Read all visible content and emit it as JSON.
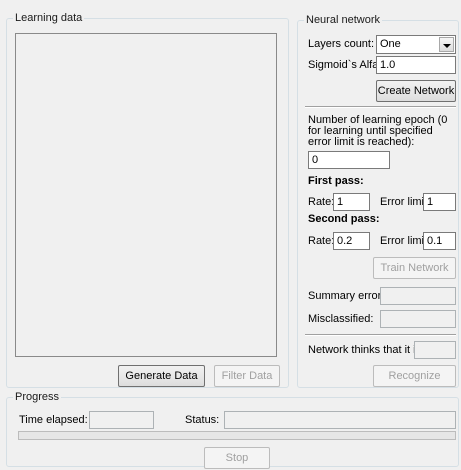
{
  "learning_data": {
    "title": "Learning data",
    "generate_label": "Generate Data",
    "filter_label": "Filter Data"
  },
  "neural_network": {
    "title": "Neural network",
    "layers_label": "Layers count:",
    "layers_value": "One",
    "alfa_label": "Sigmoid`s Alfa:",
    "alfa_value": "1.0",
    "create_label": "Create Network",
    "epoch_label": "Number of learning epoch (0 for learning until specified error limit is reached):",
    "epoch_value": "0",
    "first_pass_label": "First pass:",
    "first_rate_label": "Rate:",
    "first_rate_value": "1",
    "first_limit_label": "Error limit",
    "first_limit_value": "1",
    "second_pass_label": "Second pass:",
    "second_rate_label": "Rate:",
    "second_rate_value": "0.2",
    "second_limit_label": "Error limit",
    "second_limit_value": "0.1",
    "train_label": "Train Network",
    "summary_error_label": "Summary error:",
    "misclassified_label": "Misclassified:",
    "thinks_label": "Network thinks that it is:",
    "recognize_label": "Recognize"
  },
  "progress": {
    "title": "Progress",
    "time_label": "Time elapsed:",
    "status_label": "Status:",
    "stop_label": "Stop",
    "progress_fraction": 0
  }
}
